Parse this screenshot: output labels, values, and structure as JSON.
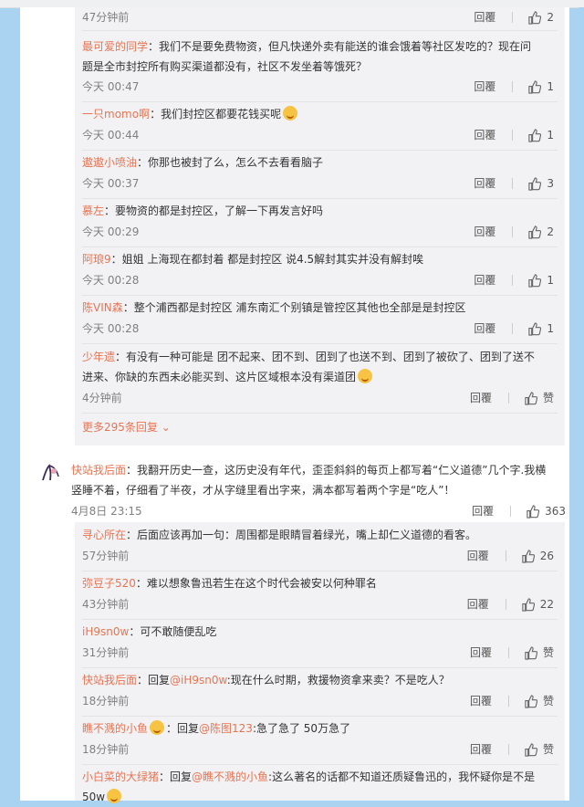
{
  "top_item": {
    "time": "47分钟前",
    "reply": "回覆",
    "likes": "2"
  },
  "nested_comments_1": [
    {
      "user": "最可爱的同学",
      "text": "：我们不是要免费物资，但凡快递外卖有能送的谁会饿着等社区发吃的？现在问题是全市封控所有购买渠道都没有，社区不发坐着等饿死？",
      "time": "今天 00:47",
      "reply": "回覆",
      "likes": "1"
    },
    {
      "user": "一只momo啊",
      "text": "：我们封控区都要花钱买呢",
      "time": "今天 00:44",
      "reply": "回覆",
      "likes": "1"
    },
    {
      "user": "遨遨小喷油",
      "text": "：你那也被封了么，怎么不去看看脑子",
      "time": "今天 00:37",
      "reply": "回覆",
      "likes": "3"
    },
    {
      "user": "慕左",
      "text": "：要物资的都是封控区，了解一下再发言好吗",
      "time": "今天 00:29",
      "reply": "回覆",
      "likes": "2"
    },
    {
      "user": "阿琅9",
      "text": "：姐姐 上海现在都封着 都是封控区 说4.5解封其实并没有解封唉",
      "time": "今天 00:28",
      "reply": "回覆",
      "likes": "1"
    },
    {
      "user": "陈VIN森",
      "text": "：整个浦西都是封控区 浦东南汇个别镇是管控区其他也全部是是封控区",
      "time": "今天 00:28",
      "reply": "回覆",
      "likes": "1"
    },
    {
      "user": "少年遗",
      "text": "：有没有一种可能是 团不起来、团不到、团到了也送不到、团到了被砍了、团到了送不进来、你缺的东西未必能买到、这片区域根本没有渠道团",
      "time": "4分钟前",
      "reply": "回覆",
      "likes": "赞"
    }
  ],
  "more_replies": "更多295条回复",
  "main_comment": {
    "user": "快站我后面",
    "text": "：我翻开历史一查，这历史没有年代，歪歪斜斜的每页上都写着“仁义道德”几个字.我横竖睡不着，仔细看了半夜，才从字缝里看出字来，满本都写着两个字是“吃人”！",
    "time": "4月8日 23:15",
    "reply": "回覆",
    "likes": "363"
  },
  "nested_comments_2": [
    {
      "user": "寻心所在",
      "text": "：后面应该再加一句：周围都是眼睛冒着绿光，嘴上却仁义道德的看客。",
      "time": "57分钟前",
      "reply": "回覆",
      "likes": "26"
    },
    {
      "user": "弥豆子520",
      "text": "：难以想象鲁迅若生在这个时代会被安以何种罪名",
      "time": "43分钟前",
      "reply": "回覆",
      "likes": "22"
    },
    {
      "user": "iH9sn0w",
      "text": "：可不敢随便乱吃",
      "time": "31分钟前",
      "reply": "回覆",
      "likes": "赞"
    },
    {
      "user": "快站我后面",
      "text_prefix": "：回复",
      "mention": "@iH9sn0w",
      "text": ":现在什么时期，救援物资拿来卖？不是吃人？",
      "time": "18分钟前",
      "reply": "回覆",
      "likes": "赞"
    },
    {
      "user": "瞧不溅的小鱼",
      "text_prefix": "：回复",
      "mention": "@陈图123",
      "text": ":急了急了 50万急了",
      "time": "18分钟前",
      "reply": "回覆",
      "likes": "赞"
    },
    {
      "user": "小白菜的大绿猪",
      "text_prefix": "：回复",
      "mention": "@瞧不溅的小鱼",
      "text": ":这么著名的话都不知道还质疑鲁迅的，我怀疑你是不是50w",
      "time": "",
      "reply": "",
      "likes": ""
    }
  ],
  "colors": {
    "accent": "#eb7350",
    "background": "#a9d3f0",
    "reply_box": "#f2f2f5"
  }
}
